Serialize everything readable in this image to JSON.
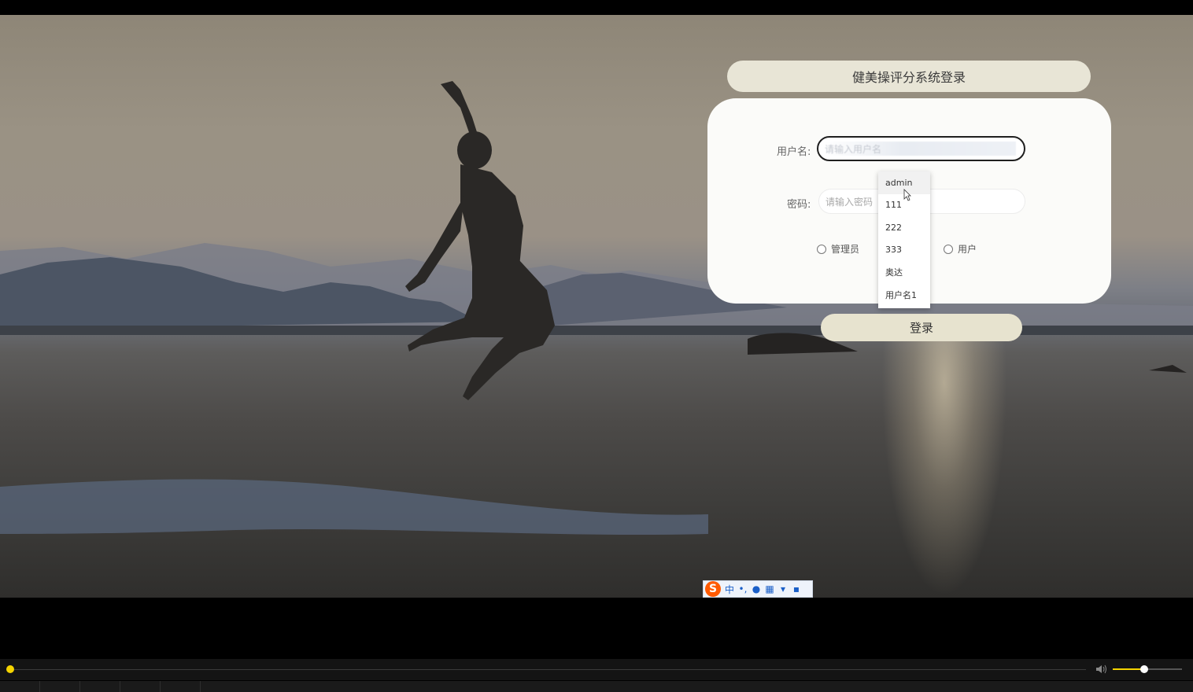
{
  "login": {
    "title": "健美操评分系统登录",
    "username_label": "用户名:",
    "username_placeholder": "请输入用户名",
    "password_label": "密码:",
    "password_placeholder": "请输入密码",
    "role_admin": "管理员",
    "role_user": "用户",
    "login_button": "登录"
  },
  "autocomplete": {
    "items": [
      "admin",
      "111",
      "222",
      "333",
      "奥达",
      "用户名1"
    ]
  },
  "ime": {
    "logo": "S",
    "mode": "中"
  },
  "player": {
    "progress": 0.0,
    "volume": 0.45
  },
  "colors": {
    "pill": "#e8e5d6",
    "panel": "#fbfbf9",
    "accent": "#f5d400"
  }
}
